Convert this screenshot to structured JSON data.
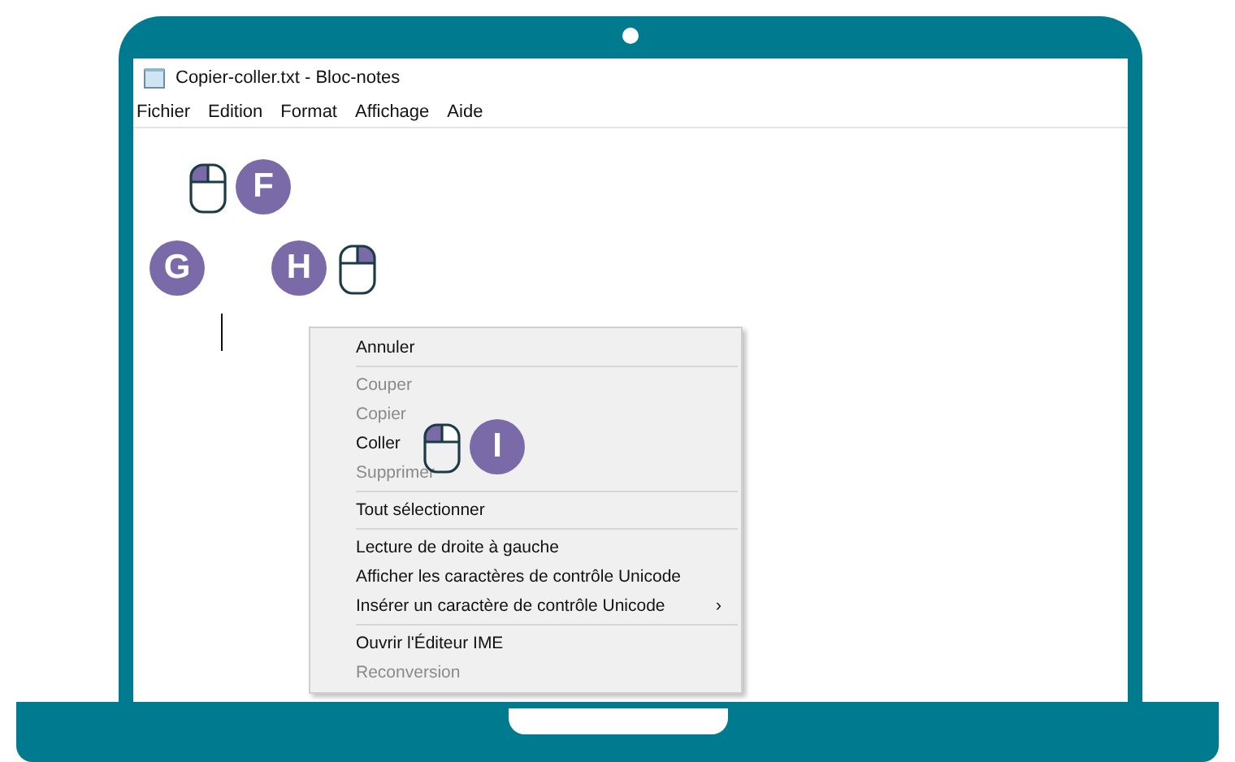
{
  "window": {
    "title": "Copier-coller.txt - Bloc-notes"
  },
  "menu_bar": [
    "Fichier",
    "Edition",
    "Format",
    "Affichage",
    "Aide"
  ],
  "markers": [
    {
      "kind": "mouse",
      "left_pressed": true,
      "right_pressed": false
    },
    {
      "kind": "badge",
      "letter": "F"
    },
    {
      "kind": "badge",
      "letter": "G"
    },
    {
      "kind": "badge",
      "letter": "H"
    },
    {
      "kind": "mouse",
      "left_pressed": false,
      "right_pressed": true
    },
    {
      "kind": "mouse",
      "left_pressed": true,
      "right_pressed": false
    },
    {
      "kind": "badge",
      "letter": "I"
    }
  ],
  "context_menu": [
    {
      "kind": "item",
      "label": "Annuler",
      "disabled": false
    },
    {
      "kind": "separator"
    },
    {
      "kind": "item",
      "label": "Couper",
      "disabled": true
    },
    {
      "kind": "item",
      "label": "Copier",
      "disabled": true
    },
    {
      "kind": "item",
      "label": "Coller",
      "disabled": false
    },
    {
      "kind": "item",
      "label": "Supprimer",
      "disabled": true
    },
    {
      "kind": "separator"
    },
    {
      "kind": "item",
      "label": "Tout sélectionner",
      "disabled": false
    },
    {
      "kind": "separator"
    },
    {
      "kind": "item",
      "label": "Lecture de droite à gauche",
      "disabled": false
    },
    {
      "kind": "item",
      "label": "Afficher les caractères de contrôle Unicode",
      "disabled": false
    },
    {
      "kind": "item",
      "label": "Insérer un caractère de contrôle Unicode",
      "disabled": false,
      "submenu": "›"
    },
    {
      "kind": "separator"
    },
    {
      "kind": "item",
      "label": "Ouvrir l'Éditeur IME",
      "disabled": false
    },
    {
      "kind": "item",
      "label": "Reconversion",
      "disabled": true
    }
  ]
}
